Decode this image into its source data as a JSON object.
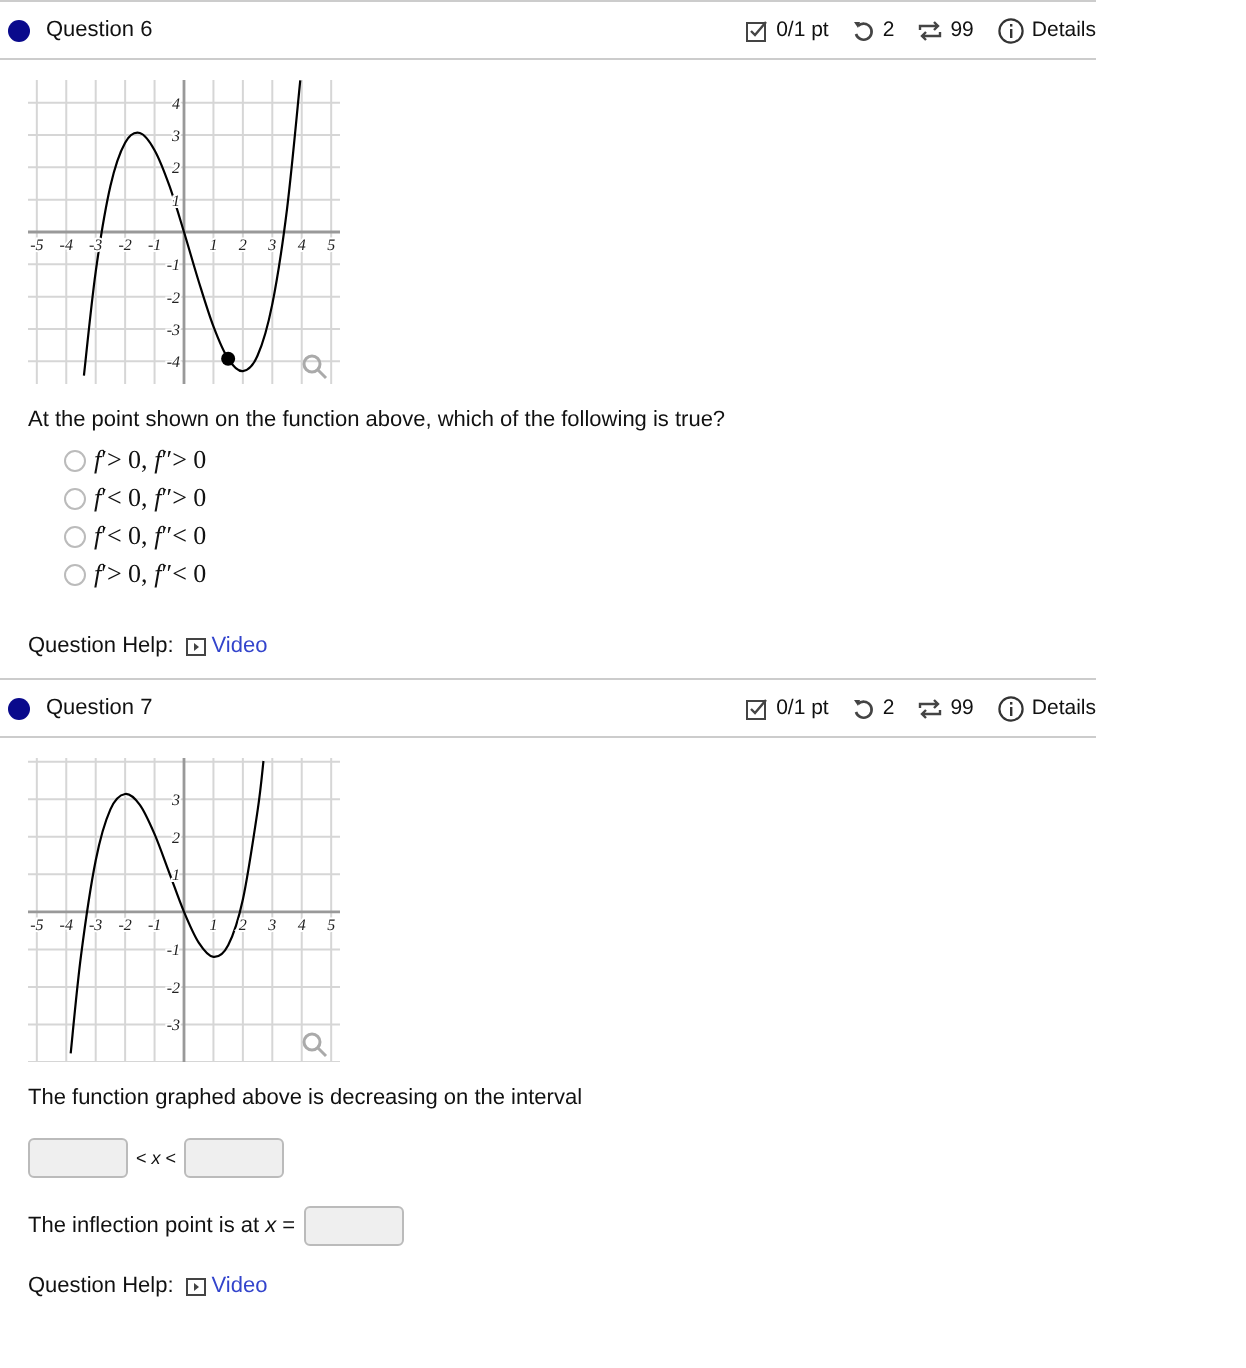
{
  "questions": [
    {
      "title": "Question 6",
      "score": "0/1 pt",
      "retries": "2",
      "attempts": "99",
      "details": "Details",
      "chart_data": {
        "type": "line",
        "grid": true,
        "x": [
          -3.4,
          -3,
          -2.5,
          -2,
          -1.5,
          -1,
          -0.5,
          0,
          0.5,
          1,
          1.5,
          2,
          2.5,
          3,
          3.5,
          3.95
        ],
        "series": [
          {
            "color": "#000000",
            "values": [
              -4.44,
              -1.23,
              1.42,
              2.76,
              3.06,
              2.53,
              1.44,
              0,
              -1.53,
              -2.92,
              -3.92,
              -4.3,
              -3.82,
              -2.23,
              0.71,
              4.69
            ]
          },
          {
            "color": "#000000",
            "marker": true,
            "values": [
              null,
              null,
              null,
              null,
              null,
              null,
              null,
              null,
              null,
              null,
              -3.92,
              null,
              null,
              null,
              null,
              null
            ]
          }
        ],
        "xlim": [
          -5.3,
          5.3
        ],
        "ylim": [
          -4.7,
          4.7
        ],
        "xticks": [
          -5,
          -4,
          -3,
          -2,
          -1,
          1,
          2,
          3,
          4,
          5
        ],
        "yticks": [
          -4,
          -3,
          -2,
          -1,
          1,
          2,
          3,
          4
        ]
      },
      "body": [
        {
          "kind": "text",
          "text": "At the point shown on the function above, which of the following is true?"
        },
        {
          "kind": "choices",
          "options": [
            {
              "label": "*f*′> 0, *f*″> 0",
              "selected": false
            },
            {
              "label": "*f*′< 0, *f*″> 0",
              "selected": false
            },
            {
              "label": "*f*′< 0, *f*″< 0",
              "selected": false
            },
            {
              "label": "*f*′> 0, *f*″< 0",
              "selected": false
            }
          ]
        }
      ],
      "help_label": "Question Help:",
      "help_link": "Video"
    },
    {
      "title": "Question 7",
      "score": "0/1 pt",
      "retries": "2",
      "attempts": "99",
      "details": "Details",
      "chart_data": {
        "type": "line",
        "grid": true,
        "x": [
          -3.85,
          -3.5,
          -3,
          -2.5,
          -2,
          -1.5,
          -1,
          -0.5,
          0,
          0.5,
          1,
          1.5,
          2,
          2.5,
          2.7
        ],
        "series": [
          {
            "color": "#000000",
            "values": [
              -3.77,
              -1.17,
              1.37,
              2.73,
              3.14,
              2.85,
              2.07,
              1.04,
              0,
              -0.82,
              -1.2,
              -0.89,
              0.33,
              2.7,
              4.02
            ]
          }
        ],
        "xlim": [
          -5.3,
          5.3
        ],
        "ylim": [
          -4,
          4.1
        ],
        "xticks": [
          -5,
          -4,
          -3,
          -2,
          -1,
          1,
          2,
          3,
          4,
          5
        ],
        "yticks": [
          -3,
          -2,
          -1,
          1,
          2,
          3
        ]
      },
      "body": [
        {
          "kind": "text",
          "text": "The function graphed above is decreasing on the interval"
        },
        {
          "kind": "interval",
          "middle": "< *x* <"
        },
        {
          "kind": "equation",
          "text": "The inflection point is at *x* ="
        }
      ],
      "help_label": "Question Help:",
      "help_link": "Video"
    }
  ]
}
